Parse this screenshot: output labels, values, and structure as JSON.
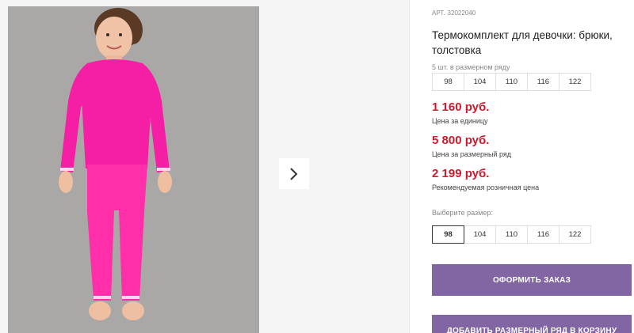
{
  "product": {
    "article_label": "АРТ.",
    "article_number": "32022040",
    "title": "Термокомплект для девочки: брюки, толстовка",
    "row_note": "5 шт. в размерном ряду",
    "row_sizes": [
      "98",
      "104",
      "110",
      "116",
      "122"
    ]
  },
  "prices": {
    "unit_price": "1 160 руб.",
    "unit_label": "Цена за единицу",
    "row_price": "5 800 руб.",
    "row_label": "Цена за размерный ряд",
    "retail_price": "2 199 руб.",
    "retail_label": "Рекомендуемая розничная цена",
    "price_color": "#d0192c"
  },
  "size_picker": {
    "label": "Выберите размер:",
    "options": [
      "98",
      "104",
      "110",
      "116",
      "122"
    ],
    "selected": "98"
  },
  "actions": {
    "order_label": "ОФОРМИТЬ ЗАКАЗ",
    "add_row_label": "ДОБАВИТЬ РАЗМЕРНЫЙ РЯД В КОРЗИНУ",
    "button_color": "#8166a3"
  },
  "gallery": {
    "next_icon": "chevron-right-icon"
  }
}
